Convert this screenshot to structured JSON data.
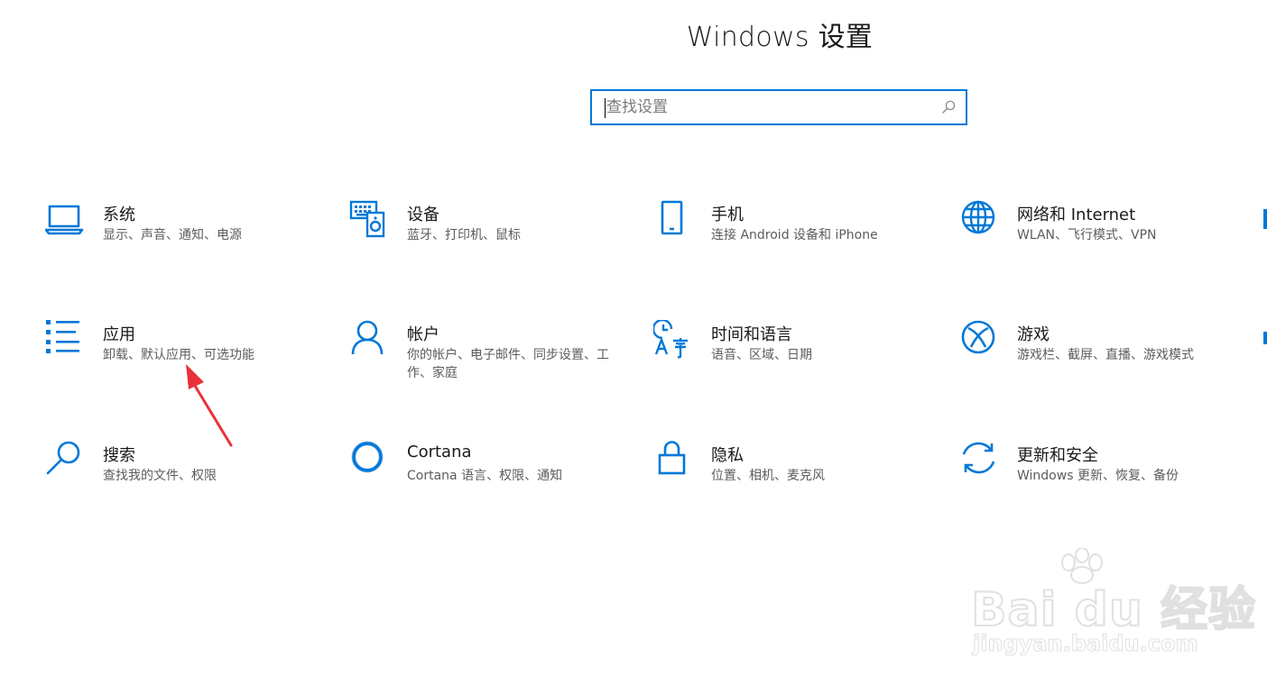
{
  "window": {
    "title": "Windows 设置"
  },
  "search": {
    "placeholder": "查找设置"
  },
  "tiles": [
    {
      "name": "系统",
      "desc": "显示、声音、通知、电源",
      "icon": "laptop-icon"
    },
    {
      "name": "设备",
      "desc": "蓝牙、打印机、鼠标",
      "icon": "keyboard-speaker-icon"
    },
    {
      "name": "手机",
      "desc": "连接 Android 设备和 iPhone",
      "icon": "phone-icon"
    },
    {
      "name": "网络和 Internet",
      "desc": "WLAN、飞行模式、VPN",
      "icon": "globe-icon"
    },
    {
      "name": "应用",
      "desc": "卸载、默认应用、可选功能",
      "icon": "app-list-icon"
    },
    {
      "name": "帐户",
      "desc": "你的帐户、电子邮件、同步设置、工作、家庭",
      "icon": "person-icon"
    },
    {
      "name": "时间和语言",
      "desc": "语音、区域、日期",
      "icon": "time-language-icon"
    },
    {
      "name": "游戏",
      "desc": "游戏栏、截屏、直播、游戏模式",
      "icon": "xbox-icon"
    },
    {
      "name": "搜索",
      "desc": "查找我的文件、权限",
      "icon": "magnifier-icon"
    },
    {
      "name": "Cortana",
      "desc": "Cortana 语言、权限、通知",
      "icon": "cortana-icon"
    },
    {
      "name": "隐私",
      "desc": "位置、相机、麦克风",
      "icon": "lock-icon"
    },
    {
      "name": "更新和安全",
      "desc": "Windows 更新、恢复、备份",
      "icon": "refresh-icon"
    }
  ],
  "watermark": {
    "brand": "Bai du 经验",
    "url": "jingyan.baidu.com"
  },
  "colors": {
    "accent": "#0078d7",
    "annotation": "#e8313a",
    "text": "#1a1a1a",
    "subtext": "#5c5c5c"
  }
}
